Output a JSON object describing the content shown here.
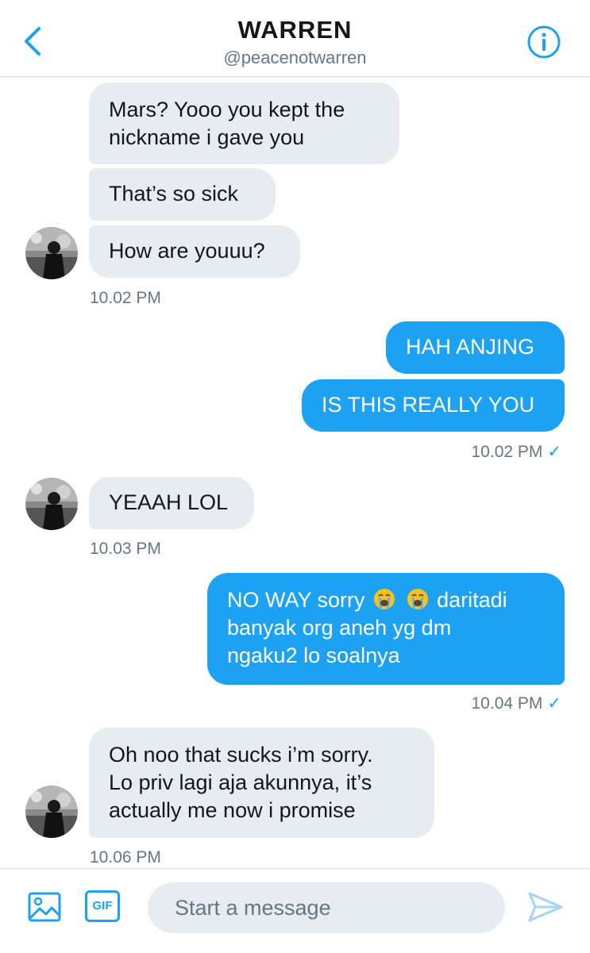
{
  "header": {
    "name": "WARREN",
    "handle": "@peacenotwarren"
  },
  "messages": [
    {
      "id": 1,
      "dir": "in",
      "text_lines": [
        "Mars? Yooo you kept the",
        "nickname i gave you"
      ]
    },
    {
      "id": 2,
      "dir": "in",
      "text": "That’s so sick"
    },
    {
      "id": 3,
      "dir": "in",
      "text": "How are youuu?"
    },
    {
      "id": 4,
      "dir": "out",
      "text": "HAH ANJING"
    },
    {
      "id": 5,
      "dir": "out",
      "text": "IS THIS REALLY YOU"
    },
    {
      "id": 6,
      "dir": "in",
      "text": "YEAAH LOL"
    },
    {
      "id": 7,
      "dir": "out",
      "line1_a": "NO WAY sorry",
      "emoji": "loudly-crying-face",
      "line1_b": "daritadi",
      "line2": "banyak org aneh yg dm",
      "line3": "ngaku2 lo soalnya"
    },
    {
      "id": 8,
      "dir": "in",
      "text_lines": [
        "Oh noo that sucks i’m sorry.",
        "Lo priv lagi aja akunnya, it’s",
        "actually me now i promise"
      ]
    }
  ],
  "timestamps": {
    "t1": "10.02 PM",
    "t2": "10.02 PM",
    "t3": "10.03 PM",
    "t4": "10.04 PM",
    "t5": "10.06 PM"
  },
  "read_mark": "✓",
  "composer": {
    "placeholder": "Start a message",
    "gif_label": "GIF"
  },
  "icons": [
    "back-chevron-icon",
    "info-icon",
    "image-icon",
    "gif-icon",
    "send-icon"
  ],
  "colors": {
    "accent": "#1da1f2",
    "incoming_bubble": "#e6ecf0",
    "muted": "#657786"
  }
}
